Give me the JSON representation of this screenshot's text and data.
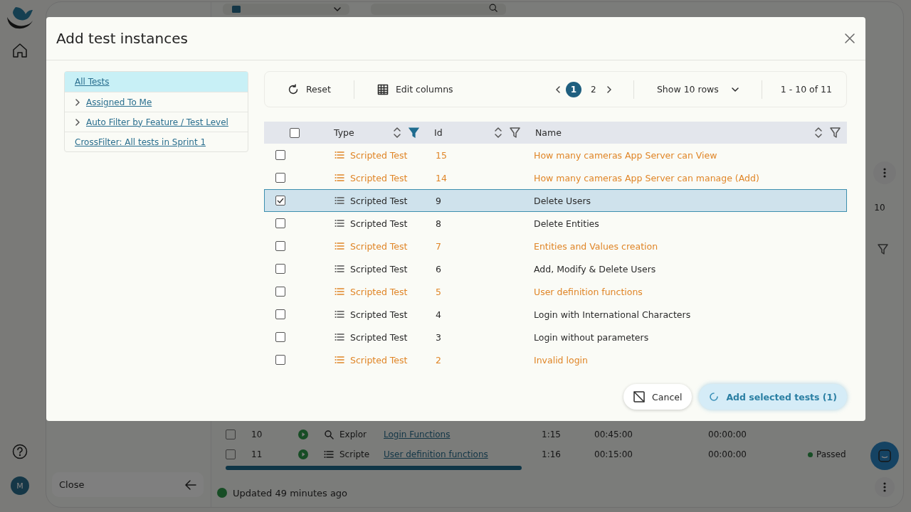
{
  "app": {
    "side_count": "10",
    "rows": [
      {
        "checked": false,
        "number": "10",
        "kind": "explore",
        "type": "Explor",
        "name": "Login Functions",
        "cells": [
          "1:15",
          "00:45:00",
          "00:00:00"
        ]
      },
      {
        "checked": false,
        "number": "11",
        "kind": "scripted",
        "type": "Scripte",
        "name": "User definition functions",
        "cells": [
          "1:16",
          "00:15:00",
          "00:00:00"
        ],
        "result": "Passed"
      }
    ],
    "close_label": "Close",
    "status": "Updated 49 minutes ago",
    "avatar": "M"
  },
  "dialog": {
    "title": "Add test instances",
    "filters": [
      {
        "label": "All Tests",
        "selected": true,
        "expandable": false
      },
      {
        "label": "Assigned To Me",
        "selected": false,
        "expandable": true
      },
      {
        "label": "Auto Filter by Feature / Test Level",
        "selected": false,
        "expandable": true
      },
      {
        "label": "CrossFilter: All tests in Sprint 1",
        "selected": false,
        "expandable": false
      }
    ],
    "toolbar": {
      "reset": "Reset",
      "edit_columns": "Edit columns",
      "pages": [
        {
          "label": "1",
          "selected": true
        },
        {
          "label": "2",
          "selected": false
        }
      ],
      "rows_option": "Show 10 rows",
      "range": "1 - 10 of 11"
    },
    "table": {
      "all_checked": false,
      "columns": [
        {
          "label": "Type",
          "filtered": true
        },
        {
          "label": "Id",
          "filtered": false
        },
        {
          "label": "Name",
          "filtered": false
        }
      ],
      "rows": [
        {
          "type": "Scripted Test",
          "id": "15",
          "name": "How many cameras App Server can View",
          "checked": false,
          "highlighted": true
        },
        {
          "type": "Scripted Test",
          "id": "14",
          "name": "How many cameras App Server can manage (Add)",
          "checked": false,
          "highlighted": true
        },
        {
          "type": "Scripted Test",
          "id": "9",
          "name": "Delete Users",
          "checked": true,
          "highlighted": false
        },
        {
          "type": "Scripted Test",
          "id": "8",
          "name": "Delete Entities",
          "checked": false,
          "highlighted": false
        },
        {
          "type": "Scripted Test",
          "id": "7",
          "name": "Entities and Values creation",
          "checked": false,
          "highlighted": true
        },
        {
          "type": "Scripted Test",
          "id": "6",
          "name": "Add, Modify & Delete Users",
          "checked": false,
          "highlighted": false
        },
        {
          "type": "Scripted Test",
          "id": "5",
          "name": "User definition functions",
          "checked": false,
          "highlighted": true
        },
        {
          "type": "Scripted Test",
          "id": "4",
          "name": "Login with International Characters",
          "checked": false,
          "highlighted": false
        },
        {
          "type": "Scripted Test",
          "id": "3",
          "name": "Login without parameters",
          "checked": false,
          "highlighted": false
        },
        {
          "type": "Scripted Test",
          "id": "2",
          "name": "Invalid login",
          "checked": false,
          "highlighted": true
        }
      ]
    },
    "buttons": {
      "cancel": "Cancel",
      "add": {
        "label": "Add selected tests (1)",
        "loading": true
      }
    }
  }
}
